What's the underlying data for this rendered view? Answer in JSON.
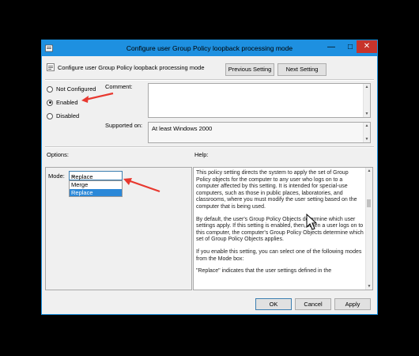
{
  "window": {
    "title": "Configure user Group Policy loopback processing mode",
    "minimize_glyph": "—",
    "maximize_glyph": "□",
    "close_glyph": "✕"
  },
  "header": {
    "policy_name": "Configure user Group Policy loopback processing mode",
    "previous_label": "Previous Setting",
    "next_label": "Next Setting"
  },
  "state": {
    "options": [
      {
        "label": "Not Configured",
        "selected": false
      },
      {
        "label": "Enabled",
        "selected": true
      },
      {
        "label": "Disabled",
        "selected": false
      }
    ]
  },
  "comment": {
    "label": "Comment:",
    "value": ""
  },
  "supported_on": {
    "label": "Supported on:",
    "value": "At least Windows 2000"
  },
  "options_section": {
    "label": "Options:",
    "mode_label": "Mode:",
    "mode_value": "Replace",
    "mode_choices": [
      "Merge",
      "Replace"
    ],
    "highlighted_choice": "Replace"
  },
  "help_section": {
    "label": "Help:",
    "paragraphs": [
      "This policy setting directs the system to apply the set of Group Policy objects for the computer to any user who logs on to a computer affected by this setting. It is intended for special-use computers, such as those in public places, laboratories, and classrooms, where you must modify the user setting based on the computer that is being used.",
      "By default, the user's Group Policy Objects determine which user settings apply. If this setting is enabled, then, when a user logs on to this computer, the computer's Group Policy Objects determine which set of Group Policy Objects applies.",
      "If you enable this setting, you can select one of the following modes from the Mode box:",
      "\"Replace\" indicates that the user settings defined in the"
    ]
  },
  "footer": {
    "ok_label": "OK",
    "cancel_label": "Cancel",
    "apply_label": "Apply"
  },
  "colors": {
    "titlebar": "#1e90e0",
    "close_button": "#c7332b",
    "annotation_arrow": "#e8382f",
    "selection": "#2b88d8"
  }
}
